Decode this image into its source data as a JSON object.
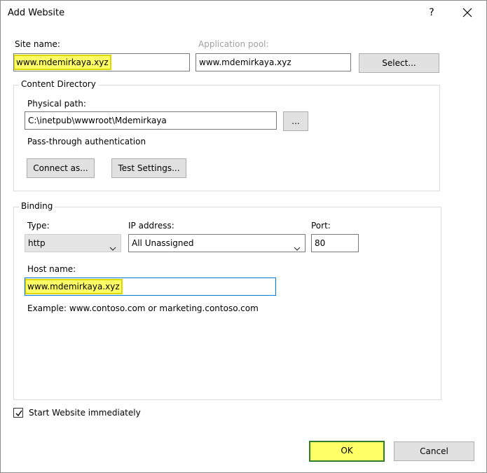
{
  "window": {
    "title": "Add Website",
    "help_glyph": "?"
  },
  "site": {
    "label": "Site name:",
    "value": "www.mdemirkaya.xyz",
    "app_pool_label": "Application pool:",
    "app_pool_value": "www.mdemirkaya.xyz",
    "select_label": "Select..."
  },
  "content": {
    "group_label": "Content Directory",
    "physical_path_label": "Physical path:",
    "physical_path_value": "C:\\inetpub\\wwwroot\\Mdemirkaya",
    "browse_label": "...",
    "passthrough_label": "Pass-through authentication",
    "connect_as_label": "Connect as...",
    "test_settings_label": "Test Settings..."
  },
  "binding": {
    "group_label": "Binding",
    "type_label": "Type:",
    "type_value": "http",
    "ip_label": "IP address:",
    "ip_value": "All Unassigned",
    "port_label": "Port:",
    "port_value": "80",
    "host_label": "Host name:",
    "host_value": "www.mdemirkaya.xyz",
    "example_text": "Example: www.contoso.com or marketing.contoso.com"
  },
  "start_immediately": {
    "label": "Start Website immediately",
    "checked": true
  },
  "footer": {
    "ok_label": "OK",
    "cancel_label": "Cancel"
  },
  "colors": {
    "highlight": "#ffff66",
    "ok_border": "#2e7d32",
    "focus_border": "#0078d7"
  }
}
